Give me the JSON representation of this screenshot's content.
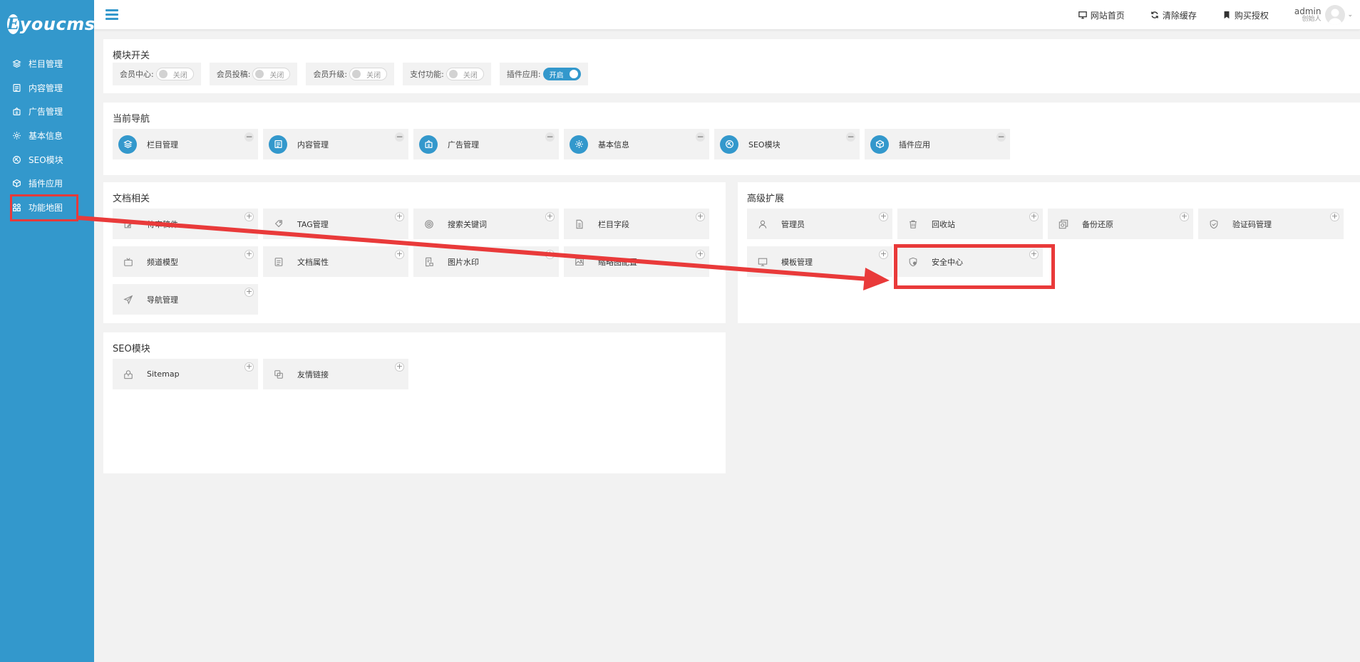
{
  "brand": {
    "logo_letter": "E",
    "logo_text": "youcms"
  },
  "sidebar": {
    "items": [
      {
        "label": "栏目管理",
        "icon": "layers-icon"
      },
      {
        "label": "内容管理",
        "icon": "document-icon"
      },
      {
        "label": "广告管理",
        "icon": "ad-icon"
      },
      {
        "label": "基本信息",
        "icon": "gear-icon"
      },
      {
        "label": "SEO模块",
        "icon": "seo-icon"
      },
      {
        "label": "插件应用",
        "icon": "cube-icon"
      },
      {
        "label": "功能地图",
        "icon": "grid-icon"
      }
    ]
  },
  "header": {
    "links": [
      {
        "label": "网站首页",
        "icon": "monitor-icon"
      },
      {
        "label": "清除缓存",
        "icon": "refresh-icon"
      },
      {
        "label": "购买授权",
        "icon": "bookmark-icon"
      }
    ],
    "user": {
      "name": "admin",
      "role": "创始人"
    }
  },
  "modules": {
    "title": "模块开关",
    "switches": [
      {
        "label": "会员中心:",
        "state": "关闭",
        "on": false
      },
      {
        "label": "会员投稿:",
        "state": "关闭",
        "on": false
      },
      {
        "label": "会员升级:",
        "state": "关闭",
        "on": false
      },
      {
        "label": "支付功能:",
        "state": "关闭",
        "on": false
      },
      {
        "label": "插件应用:",
        "state": "开启",
        "on": true
      }
    ]
  },
  "current_nav": {
    "title": "当前导航",
    "items": [
      {
        "label": "栏目管理",
        "icon": "layers-icon"
      },
      {
        "label": "内容管理",
        "icon": "document-icon"
      },
      {
        "label": "广告管理",
        "icon": "ad-icon"
      },
      {
        "label": "基本信息",
        "icon": "gear-icon"
      },
      {
        "label": "SEO模块",
        "icon": "seo-icon"
      },
      {
        "label": "插件应用",
        "icon": "cube-icon"
      }
    ]
  },
  "docs": {
    "title": "文档相关",
    "items": [
      {
        "label": "待审稿件",
        "icon": "edit-icon"
      },
      {
        "label": "TAG管理",
        "icon": "tag-icon"
      },
      {
        "label": "搜索关键词",
        "icon": "target-icon"
      },
      {
        "label": "栏目字段",
        "icon": "file-icon"
      },
      {
        "label": "频道模型",
        "icon": "tv-icon"
      },
      {
        "label": "文档属性",
        "icon": "list-icon"
      },
      {
        "label": "图片水印",
        "icon": "image-doc-icon"
      },
      {
        "label": "缩略图配置",
        "icon": "picture-icon"
      },
      {
        "label": "导航管理",
        "icon": "send-icon"
      }
    ]
  },
  "advanced": {
    "title": "高级扩展",
    "items": [
      {
        "label": "管理员",
        "icon": "user-icon"
      },
      {
        "label": "回收站",
        "icon": "trash-icon"
      },
      {
        "label": "备份还原",
        "icon": "backup-icon"
      },
      {
        "label": "验证码管理",
        "icon": "shield-check-icon"
      },
      {
        "label": "模板管理",
        "icon": "monitor-icon"
      },
      {
        "label": "安全中心",
        "icon": "shield-icon"
      }
    ]
  },
  "seo": {
    "title": "SEO模块",
    "items": [
      {
        "label": "Sitemap",
        "icon": "sitemap-icon"
      },
      {
        "label": "友情链接",
        "icon": "link-icon"
      }
    ]
  },
  "colors": {
    "primary": "#3398cc",
    "highlight": "#e93a3a",
    "tile_bg": "#f2f2f2"
  }
}
